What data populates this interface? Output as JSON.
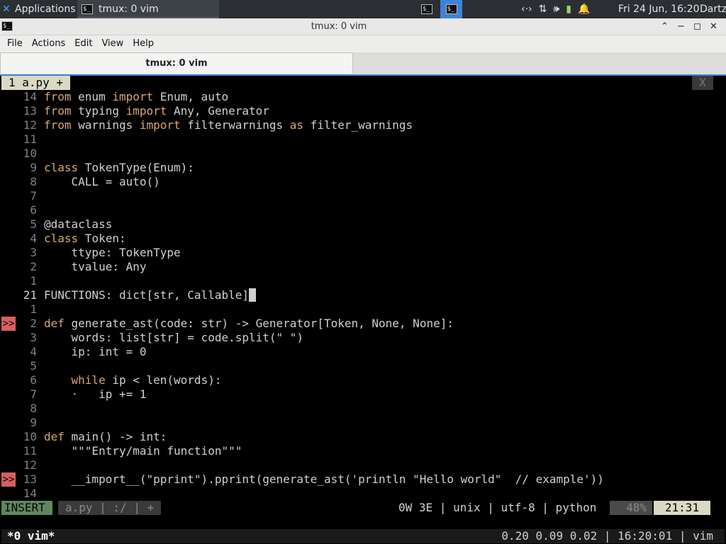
{
  "panel": {
    "apps_label": "Applications",
    "apps_icon": "xfce-logo-icon",
    "task_label": "tmux: 0 vim",
    "workspace1": "$_",
    "workspace2": "$_",
    "tray": {
      "network": "‹·›",
      "transfer": "⇅",
      "volume": "🕪",
      "battery": "▮",
      "bell": "🔔"
    },
    "clock": "Fri 24 Jun, 16:20",
    "user": "Dartz"
  },
  "window": {
    "title": "tmux: 0 vim",
    "buttons": {
      "up": "⌃",
      "min": "−",
      "max": "◻",
      "close": "✕"
    }
  },
  "menu": {
    "file": "File",
    "actions": "Actions",
    "edit": "Edit",
    "view": "View",
    "help": "Help"
  },
  "tab": {
    "label": "tmux: 0 vim"
  },
  "vim": {
    "buffer_tab": "1 a.py +",
    "close_label": "X",
    "lines": [
      {
        "num": "14",
        "sign": "",
        "segs": [
          [
            "kw",
            "from"
          ],
          [
            "t",
            " enum "
          ],
          [
            "kw",
            "import"
          ],
          [
            "t",
            " Enum, auto"
          ]
        ]
      },
      {
        "num": "13",
        "sign": "",
        "segs": [
          [
            "kw",
            "from"
          ],
          [
            "t",
            " typing "
          ],
          [
            "kw",
            "import"
          ],
          [
            "t",
            " Any, Generator"
          ]
        ]
      },
      {
        "num": "12",
        "sign": "",
        "segs": [
          [
            "kw",
            "from"
          ],
          [
            "t",
            " warnings "
          ],
          [
            "kw",
            "import"
          ],
          [
            "t",
            " filterwarnings "
          ],
          [
            "kw",
            "as"
          ],
          [
            "t",
            " filter_warnings"
          ]
        ]
      },
      {
        "num": "11",
        "sign": "",
        "segs": []
      },
      {
        "num": "10",
        "sign": "",
        "segs": []
      },
      {
        "num": "9",
        "sign": "",
        "segs": [
          [
            "kw",
            "class"
          ],
          [
            "t",
            " TokenType(Enum):"
          ]
        ]
      },
      {
        "num": "8",
        "sign": "",
        "segs": [
          [
            "t",
            "    CALL = auto()"
          ]
        ]
      },
      {
        "num": "7",
        "sign": "",
        "segs": []
      },
      {
        "num": "6",
        "sign": "",
        "segs": []
      },
      {
        "num": "5",
        "sign": "",
        "segs": [
          [
            "t",
            "@dataclass"
          ]
        ]
      },
      {
        "num": "4",
        "sign": "",
        "segs": [
          [
            "kw",
            "class"
          ],
          [
            "t",
            " Token:"
          ]
        ]
      },
      {
        "num": "3",
        "sign": "",
        "segs": [
          [
            "t",
            "    ttype: TokenType"
          ]
        ]
      },
      {
        "num": "2",
        "sign": "",
        "segs": [
          [
            "t",
            "    tvalue: Any"
          ]
        ]
      },
      {
        "num": "1",
        "sign": "",
        "segs": []
      },
      {
        "num": "21",
        "sign": "",
        "cur": true,
        "segs": [
          [
            "t",
            "FUNCTIONS: dict[str, Callable]"
          ],
          [
            "cursor",
            " "
          ]
        ]
      },
      {
        "num": "1",
        "sign": "",
        "segs": []
      },
      {
        "num": "2",
        "sign": ">>",
        "segs": [
          [
            "kw",
            "def"
          ],
          [
            "t",
            " generate_ast(code: str) -> Generator[Token, None, None]:"
          ]
        ]
      },
      {
        "num": "3",
        "sign": "",
        "segs": [
          [
            "t",
            "    words: list[str] = code.split(\" \")"
          ]
        ]
      },
      {
        "num": "4",
        "sign": "",
        "segs": [
          [
            "t",
            "    ip: int = 0"
          ]
        ]
      },
      {
        "num": "5",
        "sign": "",
        "segs": []
      },
      {
        "num": "6",
        "sign": "",
        "segs": [
          [
            "t",
            "    "
          ],
          [
            "kw",
            "while"
          ],
          [
            "t",
            " ip < len(words):"
          ]
        ]
      },
      {
        "num": "7",
        "sign": "",
        "segs": [
          [
            "gray",
            "    ·   "
          ],
          [
            "t",
            "ip += 1"
          ]
        ]
      },
      {
        "num": "8",
        "sign": "",
        "segs": []
      },
      {
        "num": "9",
        "sign": "",
        "segs": []
      },
      {
        "num": "10",
        "sign": "",
        "segs": [
          [
            "kw",
            "def"
          ],
          [
            "t",
            " main() -> int:"
          ]
        ]
      },
      {
        "num": "11",
        "sign": "",
        "segs": [
          [
            "t",
            "    \"\"\"Entry/main function\"\"\""
          ]
        ]
      },
      {
        "num": "12",
        "sign": "",
        "segs": []
      },
      {
        "num": "13",
        "sign": ">>",
        "segs": [
          [
            "t",
            "    __import__(\"pprint\").pprint(generate_ast('println \"Hello world\"  // example'))"
          ]
        ]
      },
      {
        "num": "14",
        "sign": "",
        "segs": []
      }
    ],
    "status": {
      "mode": "INSERT",
      "bufinfo": "a.py | :/ | +",
      "fileinfo": "0W 3E | unix | utf-8 | python",
      "percent": "48%",
      "position": "21:31"
    }
  },
  "tmux": {
    "window": "*0 vim*",
    "right": "0.20 0.09 0.02 | 16:20:01 | vim"
  },
  "colors": {
    "accent": "#3b84d8",
    "sign": "#d75f5f",
    "keyword": "#d7a86e",
    "mode": "#5f875f"
  }
}
